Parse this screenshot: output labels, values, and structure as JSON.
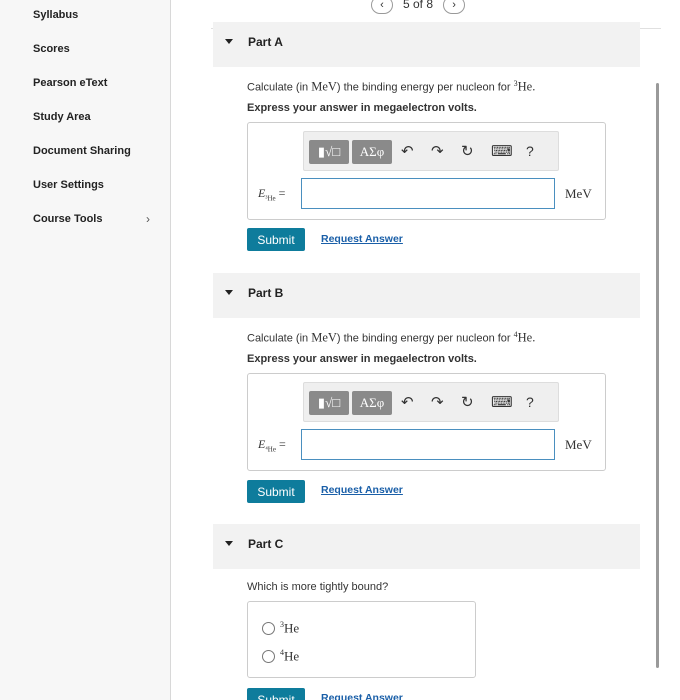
{
  "sidebar": {
    "items": [
      {
        "label": "Syllabus"
      },
      {
        "label": "Scores"
      },
      {
        "label": "Pearson eText"
      },
      {
        "label": "Study Area"
      },
      {
        "label": "Document Sharing"
      },
      {
        "label": "User Settings"
      },
      {
        "label": "Course Tools",
        "chevron": "›"
      }
    ]
  },
  "pager": {
    "prev": "‹",
    "label": "5 of 8",
    "next": "›"
  },
  "toolbar": {
    "templates": "▮√□",
    "symbols": "ΑΣφ",
    "undo": "↶",
    "redo": "↷",
    "reset": "↻",
    "keyboard": "⌨",
    "help": "?"
  },
  "parts": [
    {
      "title": "Part A",
      "question_prefix": "Calculate (in ",
      "question_unit": "MeV",
      "question_mid": ") the binding energy per nucleon for ",
      "question_mass": "3",
      "question_element": "He",
      "question_end": ".",
      "instruction": "Express your answer in megaelectron volts.",
      "var_symbol": "E",
      "var_sub": "³He",
      "var_eq": "=",
      "input_value": "",
      "unit": "MeV",
      "submit_label": "Submit",
      "request_label": "Request Answer"
    },
    {
      "title": "Part B",
      "question_prefix": "Calculate (in ",
      "question_unit": "MeV",
      "question_mid": ") the binding energy per nucleon for ",
      "question_mass": "4",
      "question_element": "He",
      "question_end": ".",
      "instruction": "Express your answer in megaelectron volts.",
      "var_symbol": "E",
      "var_sub": "⁴He",
      "var_eq": "=",
      "input_value": "",
      "unit": "MeV",
      "submit_label": "Submit",
      "request_label": "Request Answer"
    },
    {
      "title": "Part C",
      "question": "Which is more tightly bound?",
      "options": [
        {
          "mass": "3",
          "element": "He"
        },
        {
          "mass": "4",
          "element": "He"
        }
      ],
      "submit_label": "Submit",
      "request_label": "Request Answer"
    }
  ]
}
